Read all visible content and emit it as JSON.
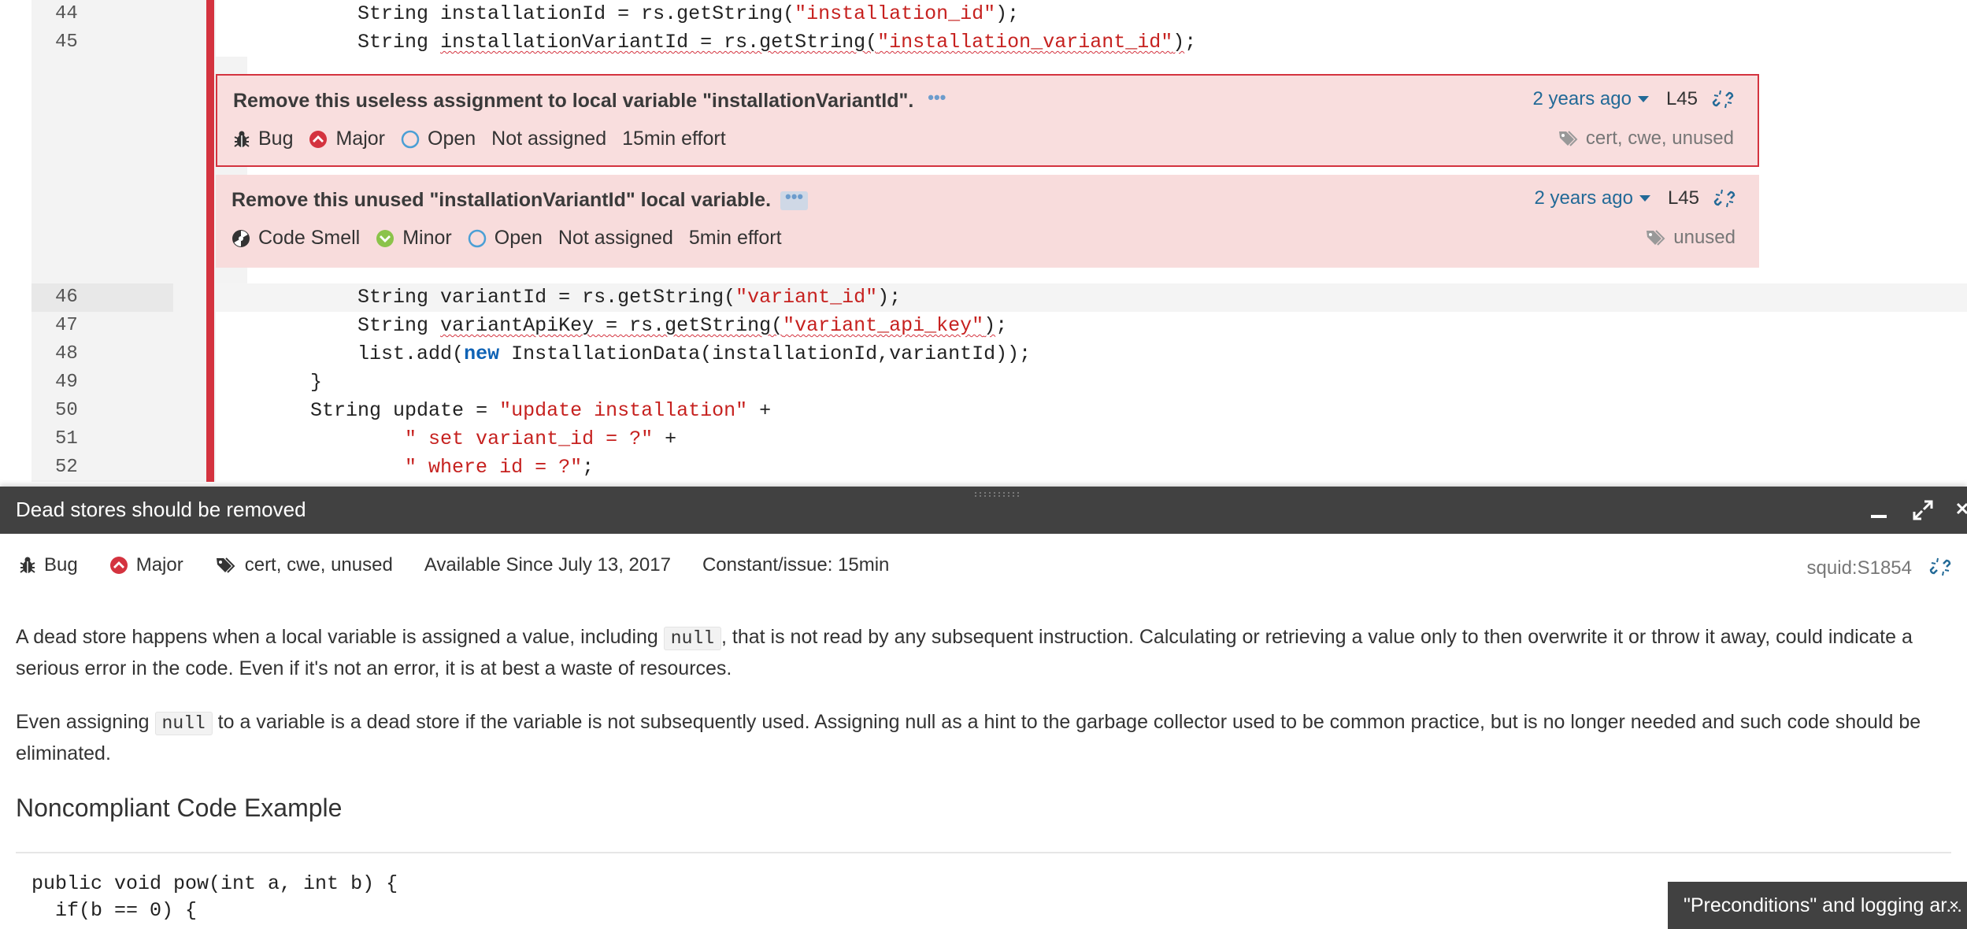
{
  "code": {
    "lines": [
      {
        "num": "44",
        "indent": "            ",
        "parts": [
          [
            "String installationId = rs.getString(",
            ""
          ],
          [
            "\"installation_id\"",
            "str"
          ],
          [
            ");",
            ""
          ]
        ]
      },
      {
        "num": "45",
        "indent": "            ",
        "issue_count": "2",
        "parts": [
          [
            "String ",
            ""
          ],
          [
            "installationVariantId = rs.getString(\"installation_variant_id\")",
            "squig-mixed"
          ],
          [
            ";",
            ""
          ]
        ]
      },
      {
        "num": "46",
        "indent": "            ",
        "parts": [
          [
            "String variantId = rs.getString(",
            ""
          ],
          [
            "\"variant_id\"",
            "str"
          ],
          [
            ");",
            ""
          ]
        ]
      },
      {
        "num": "47",
        "indent": "            ",
        "issue_count": "2",
        "parts": [
          [
            "String ",
            ""
          ],
          [
            "variantApiKey = rs.getString(\"variant_api_key\")",
            "squig-mixed"
          ],
          [
            ";",
            ""
          ]
        ]
      },
      {
        "num": "48",
        "indent": "            ",
        "parts": [
          [
            "list.add(",
            ""
          ],
          [
            "new",
            "kw"
          ],
          [
            " InstallationData(installationId,variantId));",
            ""
          ]
        ]
      },
      {
        "num": "49",
        "indent": "        ",
        "parts": [
          [
            "}",
            ""
          ]
        ]
      },
      {
        "num": "50",
        "indent": "        ",
        "parts": [
          [
            "String update = ",
            ""
          ],
          [
            "\"update installation\"",
            "str"
          ],
          [
            " +",
            ""
          ]
        ]
      },
      {
        "num": "51",
        "indent": "                ",
        "parts": [
          [
            "\" set variant_id = ?\"",
            "str"
          ],
          [
            " +",
            ""
          ]
        ]
      },
      {
        "num": "52",
        "indent": "                ",
        "parts": [
          [
            "\" where id = ?\"",
            "str"
          ],
          [
            ";",
            ""
          ]
        ]
      }
    ]
  },
  "issues": [
    {
      "message": "Remove this useless assignment to local variable \"installationVariantId\".",
      "more": "•••",
      "type": "Bug",
      "severity": "Major",
      "status": "Open",
      "assignee": "Not assigned",
      "effort": "15min effort",
      "age": "2 years ago",
      "line": "L45",
      "tags": "cert, cwe, unused"
    },
    {
      "message": "Remove this unused \"installationVariantId\" local variable.",
      "more": "•••",
      "type": "Code Smell",
      "severity": "Minor",
      "status": "Open",
      "assignee": "Not assigned",
      "effort": "5min effort",
      "age": "2 years ago",
      "line": "L45",
      "tags": "unused"
    }
  ],
  "rule": {
    "title": "Dead stores should be removed",
    "type": "Bug",
    "severity": "Major",
    "tags": "cert, cwe, unused",
    "available": "Available Since July 13, 2017",
    "constant": "Constant/issue: 15min",
    "key": "squid:S1854",
    "para1_a": "A dead store happens when a local variable is assigned a value, including ",
    "para1_code": "null",
    "para1_b": ", that is not read by any subsequent instruction. Calculating or retrieving a value only to then overwrite it or throw it away, could indicate a serious error in the code. Even if it's not an error, it is at best a waste of resources.",
    "para2_a": "Even assigning ",
    "para2_code": "null",
    "para2_b": " to a variable is a dead store if the variable is not subsequently used. Assigning null as a hint to the garbage collector used to be common practice, but is no longer needed and such code should be eliminated.",
    "heading": "Noncompliant Code Example",
    "example_line1": "public void pow(int a, int b) {",
    "example_line2": "  if(b == 0) {"
  },
  "toast": {
    "text": "\"Preconditions\" and logging ar...",
    "close": "×"
  },
  "colors": {
    "bug_red": "#d4333f",
    "minor_green": "#8bc34a",
    "link_blue": "#236a97",
    "panel_dark": "#414141"
  },
  "icons": {
    "bug": "bug-icon",
    "major": "major-severity-icon",
    "minor": "minor-severity-icon",
    "open": "open-status-icon",
    "smell": "code-smell-icon",
    "tag": "tag-icon",
    "link": "link-icon"
  }
}
